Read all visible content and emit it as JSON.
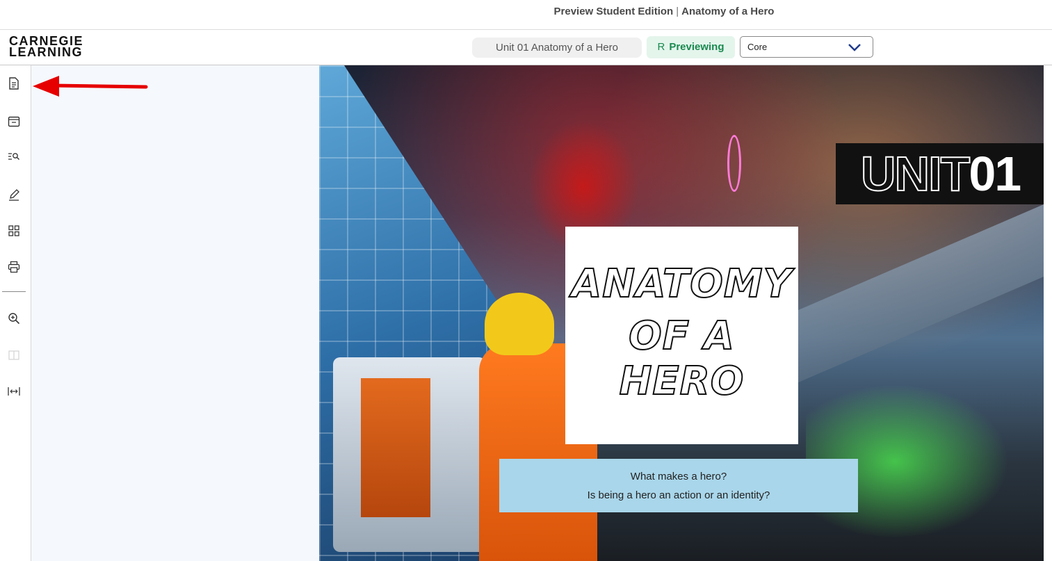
{
  "window": {
    "title_main": "Preview Student Edition",
    "title_sep": "|",
    "title_sub": "Anatomy of a Hero"
  },
  "header": {
    "logo_line1": "CARNEGIE",
    "logo_line2": "LEARNING",
    "unit_label": "Unit 01 Anatomy of a Hero",
    "preview_icon": "R",
    "preview_label": "Previewing",
    "edition_select": {
      "value": "Core"
    }
  },
  "sidebar": {
    "items": [
      {
        "name": "document-icon"
      },
      {
        "name": "window-icon"
      },
      {
        "name": "search-list-icon"
      },
      {
        "name": "pen-icon"
      },
      {
        "name": "grid-icon"
      },
      {
        "name": "print-icon"
      },
      {
        "name": "zoom-in-icon"
      },
      {
        "name": "book-icon"
      },
      {
        "name": "fit-width-icon"
      }
    ]
  },
  "cover": {
    "unit_word": "UNIT",
    "unit_number": "01",
    "title_line1": "ANATOMY",
    "title_line2": "OF A",
    "title_line3": "HERO",
    "question1": "What makes a hero?",
    "question2": "Is being a hero an action or an identity?"
  },
  "colors": {
    "preview_bg": "#e4f5ec",
    "preview_text": "#1a8a4f",
    "arrow": "#e60000",
    "question_bg": "#a9d6ea"
  }
}
